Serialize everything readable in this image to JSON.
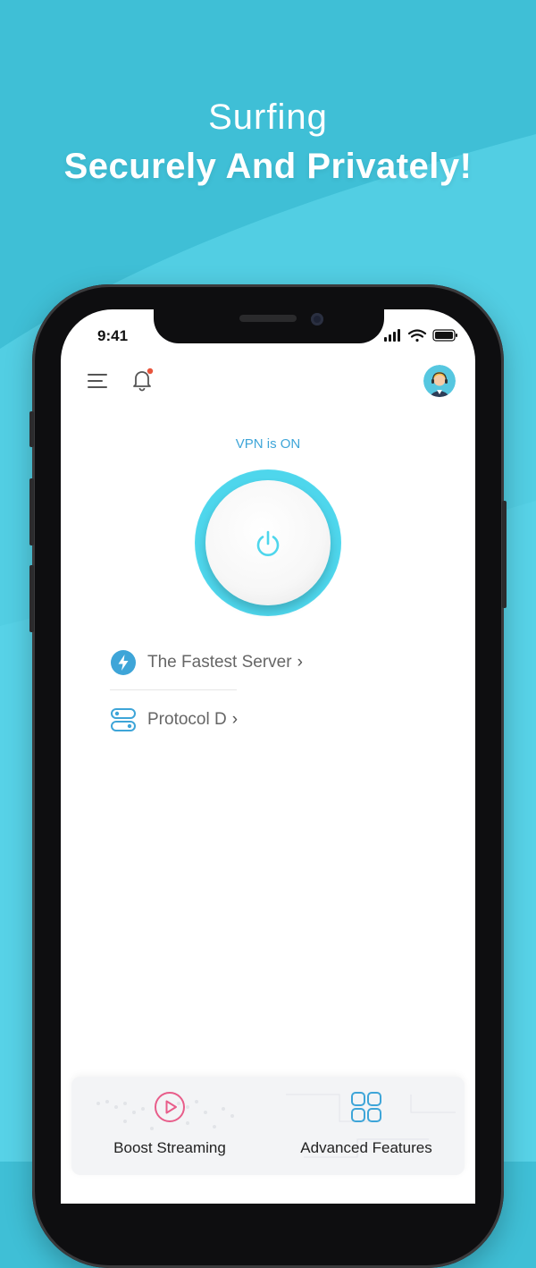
{
  "headline": {
    "line1": "Surfing",
    "line2": "Securely And Privately!"
  },
  "status_bar": {
    "time": "9:41",
    "icons": [
      "signal-icon",
      "wifi-icon",
      "battery-icon"
    ]
  },
  "top_bar": {
    "menu_icon": "menu-icon",
    "bell_icon": "bell-icon",
    "bell_badge_color": "#e8553d",
    "avatar_icon": "support-agent-avatar"
  },
  "vpn": {
    "status_text": "VPN is ON",
    "power_icon": "power-icon",
    "accent_color": "#4ed6ec"
  },
  "server": {
    "label": "The Fastest Server",
    "chevron": "›",
    "icon": "lightning-icon"
  },
  "protocol": {
    "label": "Protocol D",
    "chevron": "›",
    "icon": "toggle-icon"
  },
  "bottom_tiles": [
    {
      "label": "Boost Streaming",
      "icon": "play-circle-icon",
      "icon_color": "#e85d8a"
    },
    {
      "label": "Advanced Features",
      "icon": "grid-icon",
      "icon_color": "#3ea5d8"
    }
  ],
  "colors": {
    "background": "#3fbfd6",
    "link_blue": "#3ea5d8"
  }
}
